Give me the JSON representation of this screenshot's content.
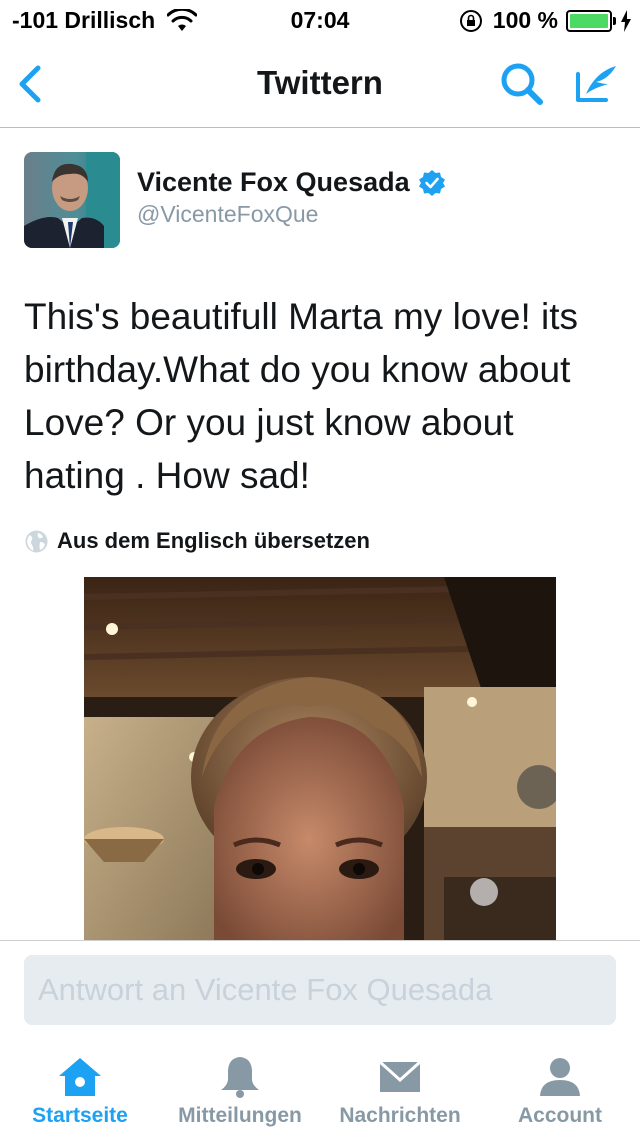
{
  "status_bar": {
    "carrier": "-101 Drillisch",
    "time": "07:04",
    "battery": "100 %",
    "battery_level": 1.0
  },
  "nav": {
    "title": "Twittern"
  },
  "tweet": {
    "author_name": "Vicente Fox Quesada",
    "author_handle": "@VicenteFoxQue",
    "text": "This's  beautifull Marta my love! its birthday.What do you know about Love? Or you just know about hating . How sad!",
    "translate_label": "Aus dem Englisch übersetzen"
  },
  "reply": {
    "placeholder": "Antwort an Vicente Fox Quesada"
  },
  "tabs": [
    {
      "label": "Startseite",
      "icon": "home-icon",
      "active": true
    },
    {
      "label": "Mitteilungen",
      "icon": "bell-icon",
      "active": false
    },
    {
      "label": "Nachrichten",
      "icon": "envelope-icon",
      "active": false
    },
    {
      "label": "Account",
      "icon": "person-icon",
      "active": false
    }
  ],
  "colors": {
    "accent": "#1da1f2",
    "secondary_text": "#8899a6",
    "battery_green": "#4cd964"
  }
}
